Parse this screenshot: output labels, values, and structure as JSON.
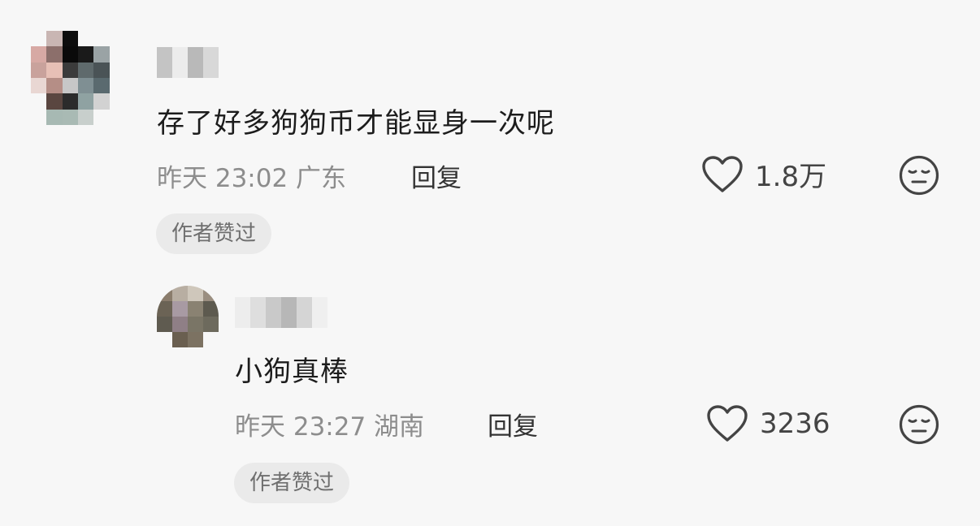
{
  "comment": {
    "text": "存了好多狗狗币才能显身一次呢",
    "meta": "昨天 23:02 广东",
    "reply_label": "回复",
    "like_count": "1.8万",
    "badge": "作者赞过",
    "like_icon": "heart-outline-icon",
    "emoji_icon": "neutral-face-icon",
    "avatar_pixels": [
      "#f7f7f7",
      "#c9b6b3",
      "#0d0d0d",
      "#f7f7f7",
      "#f7f7f7",
      "#f7f7f7",
      "#d7a9a4",
      "#8c6f6b",
      "#0a0a0a",
      "#1a1a1a",
      "#9aa3a5",
      "#f7f7f7",
      "#c9a29c",
      "#e7c0b6",
      "#3b3b3b",
      "#5f6a6c",
      "#4a5356",
      "#f7f7f7",
      "#e9d7d3",
      "#b58e86",
      "#c7c7c7",
      "#7f8f93",
      "#5a6a6f",
      "#f7f7f7",
      "#f7f7f7",
      "#5a4640",
      "#2b2b2b",
      "#8fa2a2",
      "#d2d2d2",
      "#f7f7f7",
      "#f7f7f7",
      "#a7b9b3",
      "#a9bab4",
      "#c8cfcc",
      "#f7f7f7",
      "#f7f7f7"
    ],
    "name_pixels": [
      "#c4c4c4",
      "#ececec",
      "#b9b9b9",
      "#d8d8d8",
      "#f7f7f7"
    ]
  },
  "reply": {
    "text": "小狗真棒",
    "meta": "昨天 23:27 湖南",
    "reply_label": "回复",
    "like_count": "3236",
    "badge": "作者赞过",
    "like_icon": "heart-outline-icon",
    "emoji_icon": "neutral-face-icon",
    "avatar_pixels": [
      "#8a7c6c",
      "#b8aea2",
      "#cfc7bb",
      "#9a8e80",
      "#6b6355",
      "#a89aa3",
      "#8a8272",
      "#5d5a4f",
      "#5f5b50",
      "#8f7f86",
      "#7a7566",
      "#6d6a5d",
      "#f7f7f7",
      "#6a5f50",
      "#7c7262",
      "#f7f7f7"
    ],
    "name_pixels": [
      "#ededed",
      "#dedede",
      "#c9c9c9",
      "#b7b7b7",
      "#d5d5d5",
      "#efefef"
    ]
  }
}
